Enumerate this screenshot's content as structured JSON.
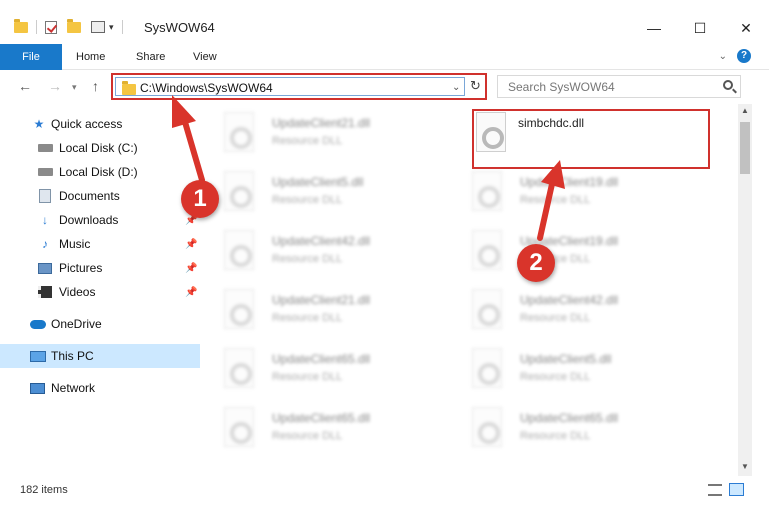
{
  "window": {
    "title": "SysWOW64",
    "minimize_label": "—",
    "maximize_label": "☐",
    "close_label": "✕"
  },
  "ribbon": {
    "tabs": [
      "File",
      "Home",
      "Share",
      "View"
    ]
  },
  "nav": {
    "address": "C:\\Windows\\SysWOW64",
    "search_placeholder": "Search SysWOW64"
  },
  "sidebar": {
    "items": [
      {
        "label": "Quick access",
        "icon": "star-icon"
      },
      {
        "label": "Local Disk (C:)",
        "icon": "disk-icon"
      },
      {
        "label": "Local Disk (D:)",
        "icon": "disk-icon"
      },
      {
        "label": "Documents",
        "icon": "documents-icon"
      },
      {
        "label": "Downloads",
        "icon": "downloads-icon"
      },
      {
        "label": "Music",
        "icon": "music-icon"
      },
      {
        "label": "Pictures",
        "icon": "pictures-icon"
      },
      {
        "label": "Videos",
        "icon": "videos-icon"
      },
      {
        "label": "OneDrive",
        "icon": "onedrive-icon"
      },
      {
        "label": "This PC",
        "icon": "this-pc-icon"
      },
      {
        "label": "Network",
        "icon": "network-icon"
      }
    ]
  },
  "files": {
    "left": [
      {
        "name": "UpdateClient21.dll",
        "type": "Resource DLL"
      },
      {
        "name": "UpdateClient5.dll",
        "type": "Resource DLL"
      },
      {
        "name": "UpdateClient42.dll",
        "type": "Resource DLL"
      },
      {
        "name": "UpdateClient21.dll",
        "type": "Resource DLL"
      },
      {
        "name": "UpdateClient65.dll",
        "type": "Resource DLL"
      },
      {
        "name": "UpdateClient65.dll",
        "type": "Resource DLL"
      }
    ],
    "right": [
      {
        "name": "simbchdc.dll",
        "type": ""
      },
      {
        "name": "UpdateClient19.dll",
        "type": "Resource DLL"
      },
      {
        "name": "UpdateClient19.dll",
        "type": "Resource DLL"
      },
      {
        "name": "UpdateClient42.dll",
        "type": "Resource DLL"
      },
      {
        "name": "UpdateClient5.dll",
        "type": "Resource DLL"
      },
      {
        "name": "UpdateClient65.dll",
        "type": "Resource DLL"
      }
    ]
  },
  "status": {
    "item_count": "182 items"
  },
  "annotations": {
    "step1": "1",
    "step2": "2",
    "color": "#d9342b"
  }
}
